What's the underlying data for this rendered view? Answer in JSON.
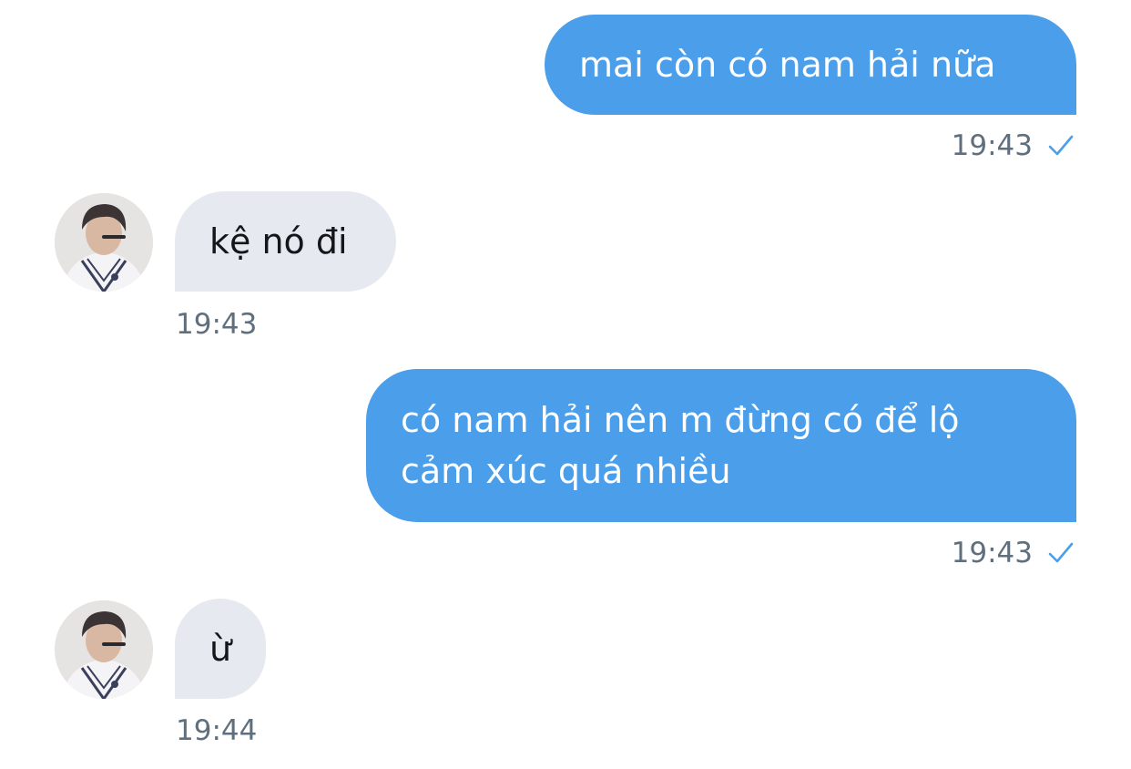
{
  "colors": {
    "outgoing_bubble": "#4b9ee9",
    "incoming_bubble": "#e7e9f0",
    "timestamp": "#5f6f7d",
    "check": "#4b9ee9"
  },
  "messages": [
    {
      "direction": "outgoing",
      "text": "mai còn có nam hải nữa",
      "time": "19:43",
      "status_icon": "check-icon"
    },
    {
      "direction": "incoming",
      "text": "kệ nó đi",
      "time": "19:43",
      "avatar": "avatar"
    },
    {
      "direction": "outgoing",
      "text": "có nam hải nên m đừng có để lộ cảm xúc quá nhiều",
      "time": "19:43",
      "status_icon": "check-icon"
    },
    {
      "direction": "incoming",
      "text": "ừ",
      "time": "19:44",
      "avatar": "avatar"
    }
  ]
}
